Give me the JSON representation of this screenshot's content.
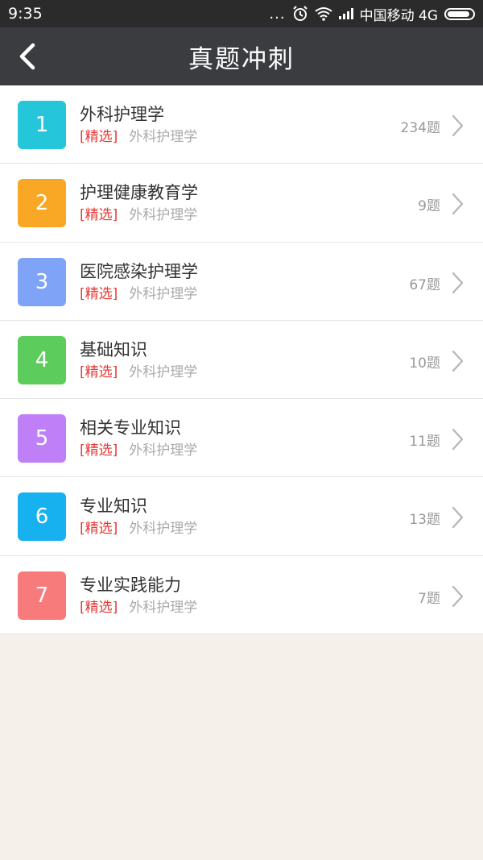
{
  "status_bar": {
    "time": "9:35",
    "dots": "...",
    "carrier": "中国移动 4G"
  },
  "header": {
    "title": "真题冲刺"
  },
  "items": [
    {
      "number": "1",
      "name": "外科护理学",
      "tag": "[精选]",
      "category": "外科护理学",
      "count": "234题",
      "color": "#26c6da"
    },
    {
      "number": "2",
      "name": "护理健康教育学",
      "tag": "[精选]",
      "category": "外科护理学",
      "count": "9题",
      "color": "#f9a825"
    },
    {
      "number": "3",
      "name": "医院感染护理学",
      "tag": "[精选]",
      "category": "外科护理学",
      "count": "67题",
      "color": "#7fa3f7"
    },
    {
      "number": "4",
      "name": "基础知识",
      "tag": "[精选]",
      "category": "外科护理学",
      "count": "10题",
      "color": "#5ccc5c"
    },
    {
      "number": "5",
      "name": "相关专业知识",
      "tag": "[精选]",
      "category": "外科护理学",
      "count": "11题",
      "color": "#bf80f7"
    },
    {
      "number": "6",
      "name": "专业知识",
      "tag": "[精选]",
      "category": "外科护理学",
      "count": "13题",
      "color": "#17b1ef"
    },
    {
      "number": "7",
      "name": "专业实践能力",
      "tag": "[精选]",
      "category": "外科护理学",
      "count": "7题",
      "color": "#f77b7b"
    }
  ],
  "icons": {
    "back": "back-arrow-icon",
    "chevron": "chevron-right-icon",
    "alarm": "alarm-icon",
    "wifi": "wifi-icon",
    "signal": "signal-icon",
    "battery": "battery-icon"
  }
}
